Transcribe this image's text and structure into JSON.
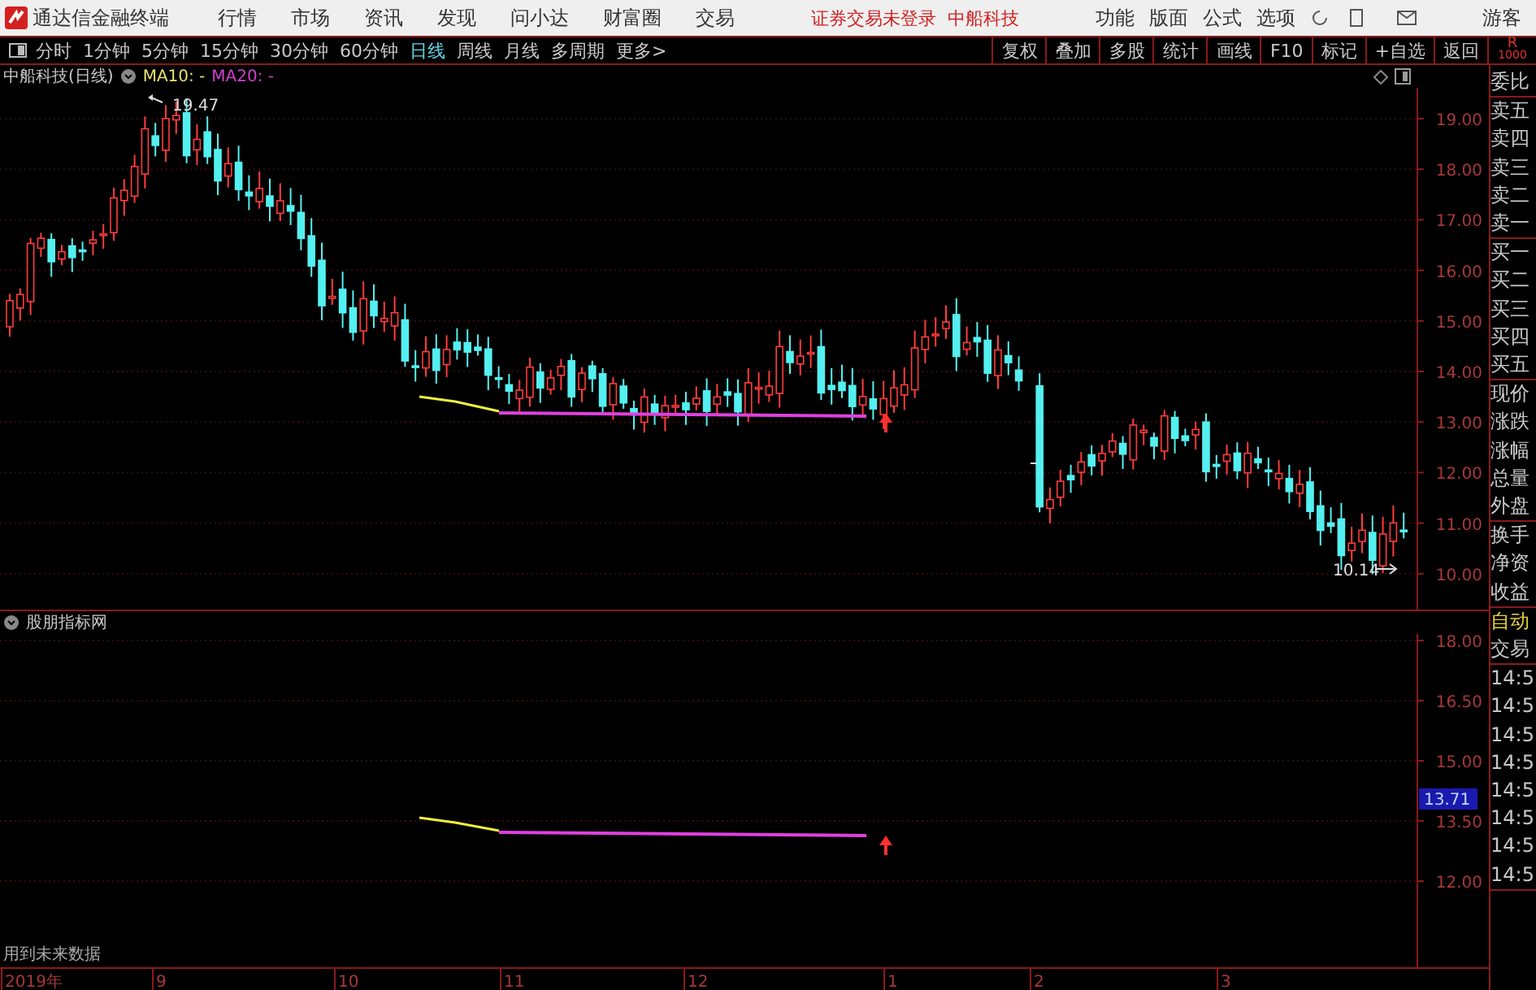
{
  "top_bar": {
    "app_title": "通达信金融终端",
    "menus": [
      "行情",
      "市场",
      "资讯",
      "发现",
      "问小达",
      "财富圈",
      "交易"
    ],
    "notice": "证券交易未登录",
    "stock": "中船科技",
    "tools": [
      "功能",
      "版面",
      "公式",
      "选项"
    ],
    "user": "游客"
  },
  "toolbar": {
    "periods": [
      {
        "label": "分时",
        "selected": false
      },
      {
        "label": "1分钟",
        "selected": false
      },
      {
        "label": "5分钟",
        "selected": false
      },
      {
        "label": "15分钟",
        "selected": false
      },
      {
        "label": "30分钟",
        "selected": false
      },
      {
        "label": "60分钟",
        "selected": false
      },
      {
        "label": "日线",
        "selected": true
      },
      {
        "label": "周线",
        "selected": false
      },
      {
        "label": "月线",
        "selected": false
      },
      {
        "label": "多周期",
        "selected": false
      },
      {
        "label": "更多>",
        "selected": false
      }
    ],
    "actions": [
      "复权",
      "叠加",
      "多股",
      "统计",
      "画线",
      "F10",
      "标记",
      "+自选",
      "返回"
    ],
    "corner": [
      "R",
      "1000"
    ]
  },
  "main_chart": {
    "title": "中船科技(日线)",
    "legend": [
      {
        "label": "MA10: -",
        "color": "#e8e070"
      },
      {
        "label": "MA20: -",
        "color": "#d040d0"
      }
    ],
    "yticks": [
      "19.00",
      "18.00",
      "17.00",
      "16.00",
      "15.00",
      "14.00",
      "13.00",
      "12.00",
      "11.00",
      "10.00"
    ],
    "annotations": [
      "19.47",
      "10.14"
    ]
  },
  "indicator": {
    "title": "股朋指标网",
    "yticks": [
      "18.00",
      "16.50",
      "15.00",
      "13.50",
      "12.00"
    ],
    "value_tag": "13.71",
    "note": "用到未来数据"
  },
  "date_axis": [
    "2019年",
    "9",
    "10",
    "11",
    "12",
    "1",
    "2",
    "3"
  ],
  "right_panel": {
    "groups": [
      [
        {
          "text": "委比",
          "kind": "field"
        }
      ],
      [
        {
          "text": "卖五",
          "kind": "field"
        },
        {
          "text": "卖四",
          "kind": "field"
        },
        {
          "text": "卖三",
          "kind": "field"
        },
        {
          "text": "卖二",
          "kind": "field"
        },
        {
          "text": "卖一",
          "kind": "field"
        }
      ],
      [
        {
          "text": "买一",
          "kind": "field"
        },
        {
          "text": "买二",
          "kind": "field"
        },
        {
          "text": "买三",
          "kind": "field"
        },
        {
          "text": "买四",
          "kind": "field"
        },
        {
          "text": "买五",
          "kind": "field"
        }
      ],
      [
        {
          "text": "现价",
          "kind": "field"
        },
        {
          "text": "涨跌",
          "kind": "field"
        },
        {
          "text": "涨幅",
          "kind": "field"
        },
        {
          "text": "总量",
          "kind": "field"
        },
        {
          "text": "外盘",
          "kind": "field"
        }
      ],
      [
        {
          "text": "换手",
          "kind": "field"
        },
        {
          "text": "净资",
          "kind": "field"
        },
        {
          "text": "收益",
          "kind": "field"
        }
      ],
      [
        {
          "text": "自动",
          "kind": "toggle"
        },
        {
          "text": "交易",
          "kind": "field"
        }
      ],
      [
        {
          "text": "14:5",
          "kind": "time"
        },
        {
          "text": "14:5",
          "kind": "time"
        },
        {
          "text": "14:5",
          "kind": "time"
        },
        {
          "text": "14:5",
          "kind": "time"
        },
        {
          "text": "14:5",
          "kind": "time"
        },
        {
          "text": "14:5",
          "kind": "time"
        },
        {
          "text": "14:5",
          "kind": "time"
        },
        {
          "text": "14:5",
          "kind": "time"
        }
      ]
    ]
  }
}
